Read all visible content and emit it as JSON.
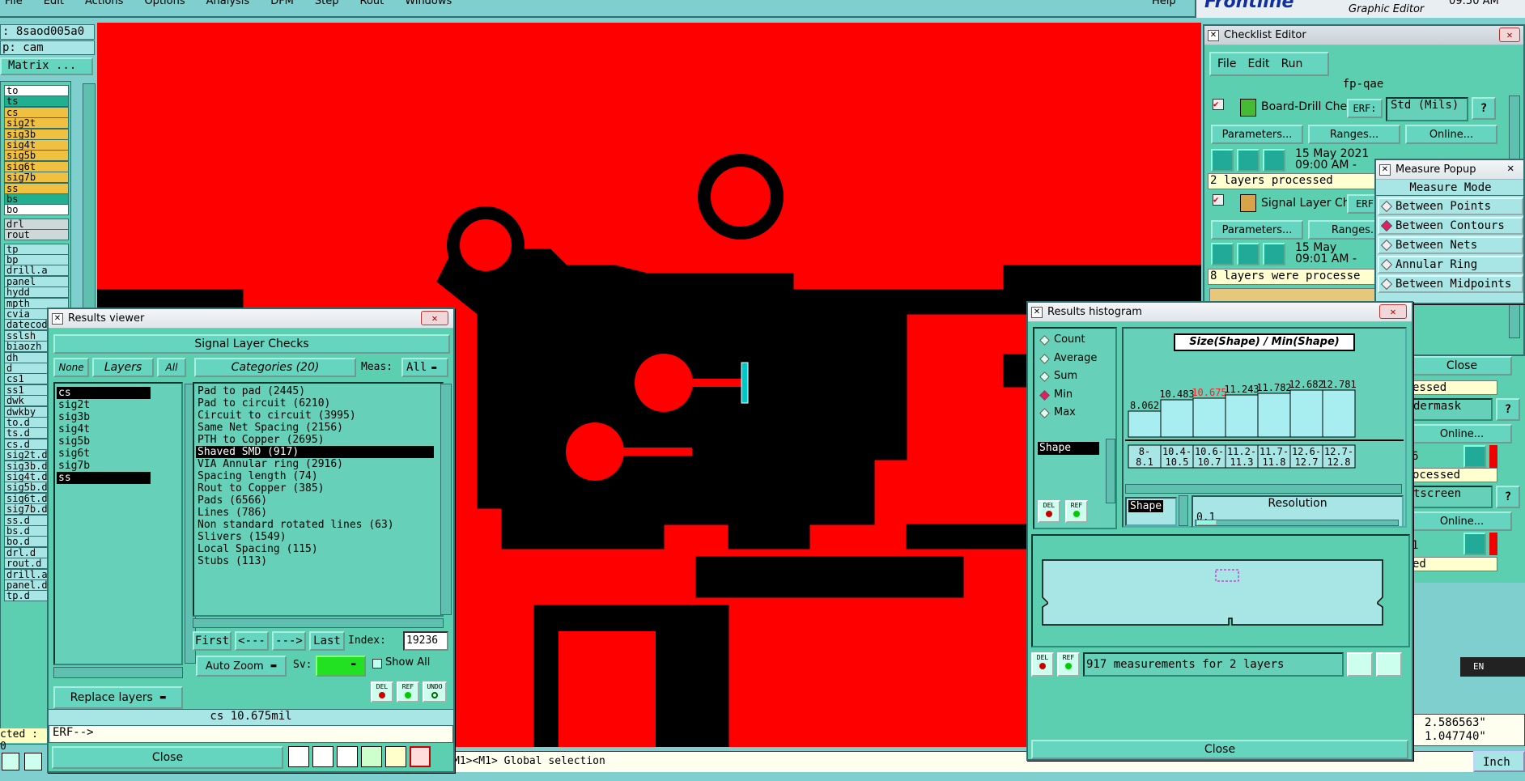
{
  "menubar": {
    "items": [
      "File",
      "Edit",
      "Actions",
      "Options",
      "Analysis",
      "DFM",
      "Step",
      "Rout",
      "Windows"
    ],
    "help": "Help",
    "brand": "Frontline",
    "brand_sub": "Graphic Editor",
    "clock": "09:50 AM"
  },
  "left_panel": {
    "job_line": ": 8saod005a0",
    "step_line": "p: cam",
    "matrix_button": "Matrix ...",
    "layers_top": [
      "to",
      "ts",
      "cs",
      "sig2t",
      "sig3b",
      "sig4t",
      "sig5b",
      "sig6t",
      "sig7b",
      "ss",
      "bs",
      "bo"
    ],
    "layers_mid": [
      "drl",
      "rout"
    ],
    "layers_low": [
      "tp",
      "bp",
      "drill.a",
      "panel",
      "hydd",
      "mpth",
      "cvia",
      "datecod",
      "sslsh",
      "biaozh",
      "dh",
      "d",
      "cs1",
      "ss1",
      "dwk",
      "dwkby",
      "to.d",
      "ts.d",
      "cs.d",
      "sig2t.d",
      "sig3b.d",
      "sig4t.d",
      "sig5b.d",
      "sig6t.d",
      "sig7b.d",
      "ss.d",
      "bs.d",
      "bo.d",
      "drl.d",
      "rout.d",
      "drill.a",
      "panel.d",
      "tp.d"
    ],
    "bottom_text": "cted : 0"
  },
  "status_bar": {
    "text": "M1><M1> Global selection",
    "coord_x": "2.586563\"",
    "coord_y": "1.047740\"",
    "units": "Inch"
  },
  "results_viewer": {
    "title": "Results viewer",
    "header": "Signal Layer Checks",
    "none_btn": "None",
    "layers_btn": "Layers",
    "all_btn": "All",
    "categories_btn": "Categories (20)",
    "meas_label": "Meas:",
    "meas_value": "All",
    "layers": [
      "cs",
      "sig2t",
      "sig3b",
      "sig4t",
      "sig5b",
      "sig6t",
      "sig7b",
      "ss"
    ],
    "categories": [
      "Pad to pad (2445)",
      "Pad to circuit (6210)",
      "Circuit to circuit (3995)",
      "Same Net Spacing (2156)",
      "PTH to Copper (2695)",
      "Shaved SMD (917)",
      "VIA Annular ring (2916)",
      "Spacing length (74)",
      "Rout to Copper (385)",
      "Pads (6566)",
      "Lines (786)",
      "Non standard rotated lines (63)",
      "Slivers (1549)",
      "Local Spacing (115)",
      "Stubs (113)"
    ],
    "first": "First",
    "prev": "<---",
    "next": "--->",
    "last": "Last",
    "index_label": "Index:",
    "index_value": "19236",
    "auto_zoom": "Auto Zoom",
    "sv_label": "Sv:",
    "show_all": "Show All",
    "replace_layers": "Replace layers",
    "del": "DEL",
    "ref": "REF",
    "undo": "UNDO",
    "result_line": "cs 10.675mil",
    "erf_line": "ERF-->",
    "close": "Close"
  },
  "checklist_editor": {
    "title": "Checklist Editor",
    "menu": [
      "File",
      "Edit",
      "Run"
    ],
    "name": "fp-qae",
    "check1": {
      "label": "Board-Drill Che",
      "erf": "ERF:",
      "std": "Std (Mils)",
      "params": "Parameters...",
      "ranges": "Ranges...",
      "online": "Online...",
      "date": "15 May 2021",
      "time": "09:00 AM -",
      "status": "2 layers processed"
    },
    "check2": {
      "label": "Signal Layer Ch",
      "erf": "ERF",
      "params": "Parameters...",
      "ranges": "Ranges..",
      "date": "15 May",
      "time": "09:01 AM -",
      "status": "8 layers were processe"
    },
    "side_items": [
      "essed",
      "dermask",
      "Online...",
      "6",
      "ocessed",
      "tscreen",
      "Online...",
      "1",
      "ed"
    ],
    "close": "Close"
  },
  "measure_popup": {
    "title": "Measure Popup",
    "header": "Measure Mode",
    "modes": [
      "Between Points",
      "Between Contours",
      "Between Nets",
      "Annular Ring",
      "Between Midpoints"
    ],
    "selected": 1
  },
  "histogram": {
    "title": "Results histogram",
    "modes": [
      "Count",
      "Average",
      "Sum",
      "Min",
      "Max"
    ],
    "selected": 3,
    "shape_tag": "Shape",
    "chart_title": "Size(Shape) / Min(Shape)",
    "bar_values": [
      "8.062",
      "10.483",
      "10.675",
      "11.243",
      "11.782",
      "12.682",
      "12.781"
    ],
    "bin_labels": [
      [
        "8-",
        "8.1"
      ],
      [
        "10.4-",
        "10.5"
      ],
      [
        "10.6-",
        "10.7"
      ],
      [
        "11.2-",
        "11.3"
      ],
      [
        "11.7-",
        "11.8"
      ],
      [
        "12.6-",
        "12.7"
      ],
      [
        "12.7-",
        "12.8"
      ]
    ],
    "shape_btn": "Shape",
    "resolution_label": "Resolution",
    "resolution_value": "0.1",
    "del": "DEL",
    "ref": "REF",
    "summary": "917 measurements for 2 layers",
    "close": "Close"
  },
  "tray": {
    "lang": "EN"
  },
  "colors": {
    "board": "#ff0000",
    "copper": "#000000",
    "ui_bg": "#5bcfb0",
    "panel_bg": "#a8e5e5",
    "highlight": "#00c8c8",
    "value_hi": "#ff2020"
  }
}
